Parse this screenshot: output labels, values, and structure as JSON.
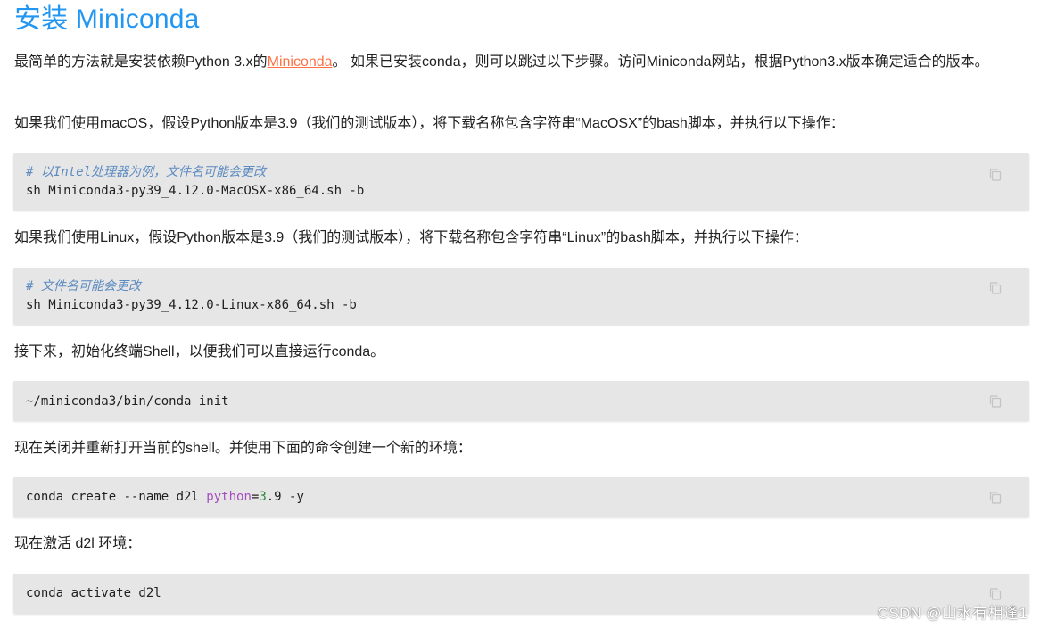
{
  "title": "安装 Miniconda",
  "intro": {
    "before_link": "最简单的方法就是安装依赖Python 3.x的",
    "link_text": "Miniconda",
    "after_link": "。 如果已安装conda，则可以跳过以下步骤。访问Miniconda网站，根据Python3.x版本确定适合的版本。"
  },
  "mac_para": "如果我们使用macOS，假设Python版本是3.9（我们的测试版本），将下载名称包含字符串“MacOSX”的bash脚本，并执行以下操作：",
  "mac_code": {
    "comment": "# 以Intel处理器为例，文件名可能会更改",
    "command": "sh Miniconda3-py39_4.12.0-MacOSX-x86_64.sh -b"
  },
  "linux_para": "如果我们使用Linux，假设Python版本是3.9（我们的测试版本），将下载名称包含字符串“Linux”的bash脚本，并执行以下操作：",
  "linux_code": {
    "comment": "# 文件名可能会更改",
    "command": "sh Miniconda3-py39_4.12.0-Linux-x86_64.sh -b"
  },
  "init_para": "接下来，初始化终端Shell，以便我们可以直接运行conda。",
  "init_code": {
    "command": "~/miniconda3/bin/conda init"
  },
  "create_para": "现在关闭并重新打开当前的shell。并使用下面的命令创建一个新的环境：",
  "create_code": {
    "prefix": "conda create --name d2l ",
    "keyword": "python",
    "equals": "=",
    "version_num": "3",
    "suffix": ".9 -y"
  },
  "activate_para": "现在激活 d2l 环境：",
  "activate_code": {
    "command": "conda activate d2l"
  },
  "copy_icon": "copy-icon",
  "watermark": "CSDN @山水有相逢1",
  "colors": {
    "title": "#2196f3",
    "link": "#ff7043",
    "code_bg": "#e6e6e6",
    "comment": "#5c8bc1",
    "keyword": "#a64dbf",
    "number": "#2a8b3a"
  }
}
